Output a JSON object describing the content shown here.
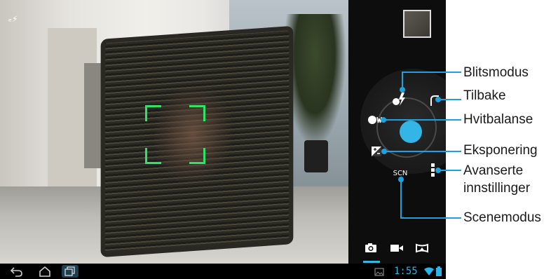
{
  "camera": {
    "flash_indicator": "ₑ⚡",
    "scene_label": "SCN",
    "white_balance_label": "A",
    "flash_auto_label": "A"
  },
  "status_bar": {
    "time": "1:55"
  },
  "callouts": {
    "flash_mode": "Blitsmodus",
    "back": "Tilbake",
    "white_balance": "Hvitbalanse",
    "exposure": "Eksponering",
    "advanced_line1": "Avanserte",
    "advanced_line2": "innstillinger",
    "scene_mode": "Scenemodus"
  },
  "colors": {
    "accent": "#33b5e5",
    "callout": "#1ea1dc",
    "focus": "#2fe36a"
  },
  "icons": [
    "flash-icon",
    "back-icon",
    "white-balance-icon",
    "exposure-icon",
    "advanced-settings-icon",
    "camera-mode-icon",
    "video-mode-icon",
    "panorama-mode-icon",
    "home-icon",
    "recent-apps-icon",
    "gallery-icon",
    "wifi-icon",
    "battery-icon"
  ]
}
